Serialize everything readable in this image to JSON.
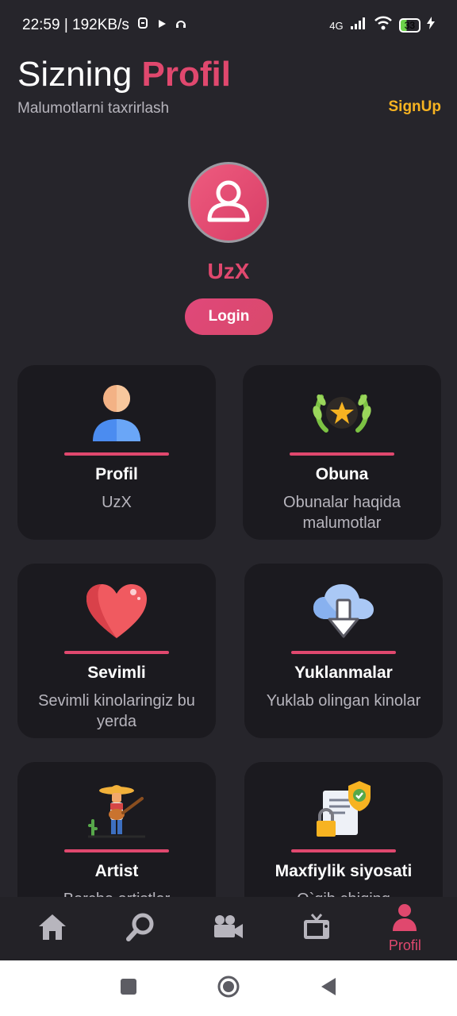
{
  "status": {
    "time": "22:59 | 192KB/s",
    "network": "4G",
    "battery": "33"
  },
  "header": {
    "title_plain": "Sizning",
    "title_accent": "Profil",
    "subtitle": "Malumotlarni taxrirlash",
    "signup": "SignUp"
  },
  "profile": {
    "username": "UzX",
    "login_label": "Login"
  },
  "cards": [
    {
      "label": "Profil",
      "desc": "UzX",
      "icon": "user-icon"
    },
    {
      "label": "Obuna",
      "desc": "Obunalar haqida malumotlar",
      "icon": "laurel-star-icon"
    },
    {
      "label": "Sevimli",
      "desc": "Sevimli kinolaringiz bu yerda",
      "icon": "heart-icon"
    },
    {
      "label": "Yuklanmalar",
      "desc": "Yuklab olingan kinolar",
      "icon": "cloud-download-icon"
    },
    {
      "label": "Artist",
      "desc": "Barcha artistlar",
      "icon": "guitarist-icon"
    },
    {
      "label": "Maxfiylik siyosati",
      "desc": "O`qib chiqing",
      "icon": "document-lock-icon"
    }
  ],
  "bottom_nav": {
    "items": [
      {
        "name": "home",
        "icon": "home-icon"
      },
      {
        "name": "search",
        "icon": "search-icon"
      },
      {
        "name": "videos",
        "icon": "video-camera-icon"
      },
      {
        "name": "tv",
        "icon": "tv-icon"
      },
      {
        "name": "profile",
        "icon": "profile-icon",
        "label": "Profil"
      }
    ]
  },
  "colors": {
    "accent": "#e0486e",
    "signup": "#f7b321",
    "background": "#26252b",
    "card": "#1b1a1f"
  }
}
